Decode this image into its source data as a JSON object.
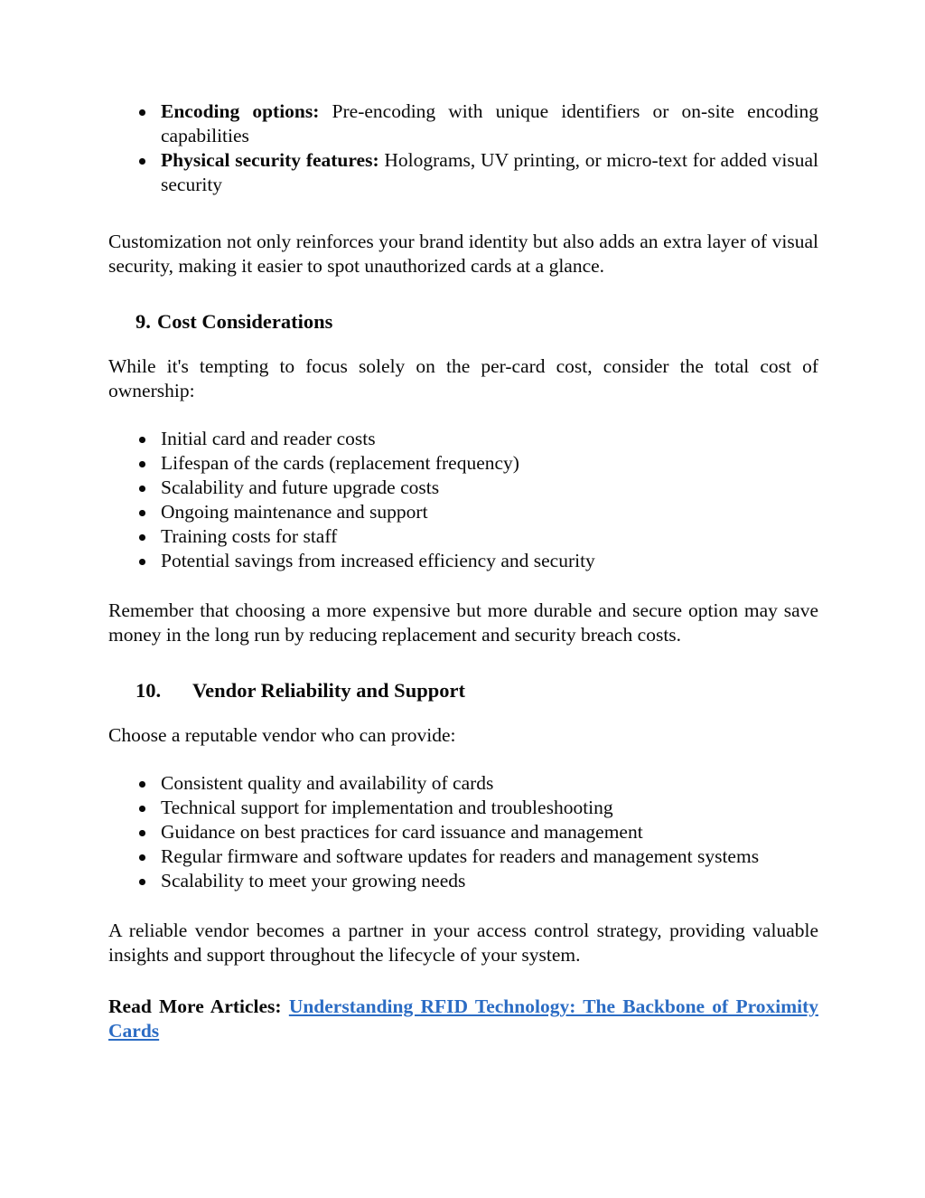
{
  "document": {
    "accent_link_color": "#2b6cc4",
    "text_color": "#0a0a0a",
    "background_color": "#ffffff"
  },
  "top_list": {
    "items": [
      {
        "lead": "Encoding options:",
        "text": " Pre-encoding with unique identifiers or on-site encoding capabilities"
      },
      {
        "lead": "Physical security features:",
        "text": " Holograms, UV printing, or micro-text for added visual security"
      }
    ]
  },
  "paragraph_customization": "Customization not only reinforces your brand identity but also adds an extra layer of visual security, making it easier to spot unauthorized cards at a glance.",
  "section_cost": {
    "number": "9.",
    "title": "Cost Considerations",
    "intro": "While it's tempting to focus solely on the per-card cost, consider the total cost of ownership:",
    "bullets": [
      "Initial card and reader costs",
      "Lifespan of the cards (replacement frequency)",
      "Scalability and future upgrade costs",
      "Ongoing maintenance and support",
      "Training costs for staff",
      "Potential savings from increased efficiency and security"
    ],
    "outro": "Remember that choosing a more expensive but more durable and secure option may save money in the long run by reducing replacement and security breach costs."
  },
  "section_vendor": {
    "number": "10.",
    "title": "Vendor Reliability and Support",
    "intro": "Choose a reputable vendor who can provide:",
    "bullets": [
      "Consistent quality and availability of cards",
      "Technical support for implementation and troubleshooting",
      "Guidance on best practices for card issuance and management",
      "Regular firmware and software updates for readers and management systems",
      "Scalability to meet your growing needs"
    ],
    "outro": "A reliable vendor becomes a partner in your access control strategy, providing valuable insights and support throughout the lifecycle of your system."
  },
  "read_more": {
    "label": "Read More Articles:",
    "link_text": "Understanding RFID Technology: The Backbone of Proximity Cards"
  }
}
